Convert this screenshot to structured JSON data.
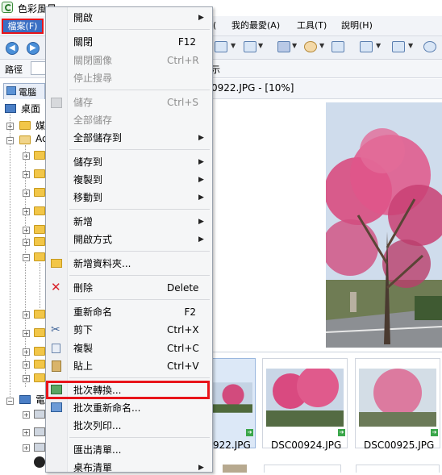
{
  "window": {
    "title": "色彩風景"
  },
  "menubar": {
    "file": "檔案(F)",
    "view_partial": "(",
    "favorites": "我的最愛(A)",
    "tools": "工具(T)",
    "help": "說明(H)"
  },
  "address": {
    "label": "路徑",
    "tail": "示"
  },
  "left_panel": {
    "tab": "電腦",
    "tree": [
      {
        "label": "桌面"
      },
      {
        "label": "媒"
      },
      {
        "label": "Ac"
      },
      {
        "label": "電"
      }
    ]
  },
  "viewer": {
    "title": "0922.JPG - [10%]"
  },
  "thumbnails": [
    {
      "label": "922.JPG"
    },
    {
      "label": "DSC00924.JPG"
    },
    {
      "label": "DSC00925.JPG"
    }
  ],
  "file_menu": {
    "groups": [
      [
        {
          "label": "開啟",
          "shortcut": "",
          "submenu": true,
          "disabled": false,
          "icon": ""
        }
      ],
      [
        {
          "label": "關閉",
          "shortcut": "F12",
          "submenu": false,
          "disabled": false,
          "icon": ""
        },
        {
          "label": "關閉圖像",
          "shortcut": "Ctrl+R",
          "submenu": false,
          "disabled": true,
          "icon": ""
        },
        {
          "label": "停止搜尋",
          "shortcut": "",
          "submenu": false,
          "disabled": true,
          "icon": ""
        }
      ],
      [
        {
          "label": "儲存",
          "shortcut": "Ctrl+S",
          "submenu": false,
          "disabled": true,
          "icon": "save-icon"
        },
        {
          "label": "全部儲存",
          "shortcut": "",
          "submenu": false,
          "disabled": true,
          "icon": ""
        },
        {
          "label": "全部儲存到",
          "shortcut": "",
          "submenu": true,
          "disabled": false,
          "icon": ""
        }
      ],
      [
        {
          "label": "儲存到",
          "shortcut": "",
          "submenu": true,
          "disabled": false,
          "icon": ""
        },
        {
          "label": "複製到",
          "shortcut": "",
          "submenu": true,
          "disabled": false,
          "icon": ""
        },
        {
          "label": "移動到",
          "shortcut": "",
          "submenu": true,
          "disabled": false,
          "icon": ""
        }
      ],
      [
        {
          "label": "新增",
          "shortcut": "",
          "submenu": true,
          "disabled": false,
          "icon": ""
        },
        {
          "label": "開啟方式",
          "shortcut": "",
          "submenu": true,
          "disabled": false,
          "icon": ""
        }
      ],
      [
        {
          "label": "新增資料夾...",
          "shortcut": "",
          "submenu": false,
          "disabled": false,
          "icon": "new-folder-icon"
        }
      ],
      [
        {
          "label": "刪除",
          "shortcut": "Delete",
          "submenu": false,
          "disabled": false,
          "icon": "delete-icon"
        }
      ],
      [
        {
          "label": "重新命名",
          "shortcut": "F2",
          "submenu": false,
          "disabled": false,
          "icon": ""
        },
        {
          "label": "剪下",
          "shortcut": "Ctrl+X",
          "submenu": false,
          "disabled": false,
          "icon": "cut-icon"
        },
        {
          "label": "複製",
          "shortcut": "Ctrl+C",
          "submenu": false,
          "disabled": false,
          "icon": "copy-icon"
        },
        {
          "label": "貼上",
          "shortcut": "Ctrl+V",
          "submenu": false,
          "disabled": false,
          "icon": "paste-icon"
        }
      ],
      [
        {
          "label": "批次轉換...",
          "shortcut": "",
          "submenu": false,
          "disabled": false,
          "icon": "batch-convert-icon"
        },
        {
          "label": "批次重新命名...",
          "shortcut": "",
          "submenu": false,
          "disabled": false,
          "icon": "batch-rename-icon"
        },
        {
          "label": "批次列印...",
          "shortcut": "",
          "submenu": false,
          "disabled": false,
          "icon": ""
        }
      ],
      [
        {
          "label": "匯出清單...",
          "shortcut": "",
          "submenu": false,
          "disabled": false,
          "icon": ""
        },
        {
          "label": "桌布清單",
          "shortcut": "",
          "submenu": true,
          "disabled": false,
          "icon": ""
        }
      ]
    ]
  },
  "colors": {
    "highlight_border": "#e8141a",
    "menu_active": "#3a6fc4",
    "blossom": "#d9447a",
    "sky": "#c9d9ec"
  }
}
